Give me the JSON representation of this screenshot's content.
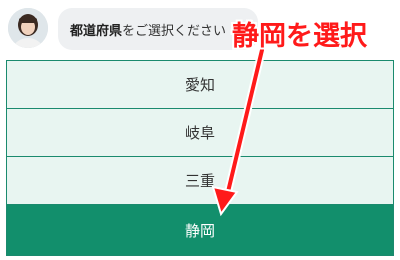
{
  "chat": {
    "prompt_bold": "都道府県",
    "prompt_rest": "をご選択ください"
  },
  "options": [
    {
      "label": "愛知",
      "selected": false
    },
    {
      "label": "岐阜",
      "selected": false
    },
    {
      "label": "三重",
      "selected": false
    },
    {
      "label": "静岡",
      "selected": true
    }
  ],
  "annotation": {
    "text": "静岡を選択",
    "color": "#ff1a1a"
  },
  "colors": {
    "accent": "#128f6c",
    "option_bg": "#e8f5f1",
    "border": "#1a8a6e"
  },
  "icons": {
    "avatar": "operator-avatar-icon",
    "arrow": "red-arrow-annotation"
  }
}
